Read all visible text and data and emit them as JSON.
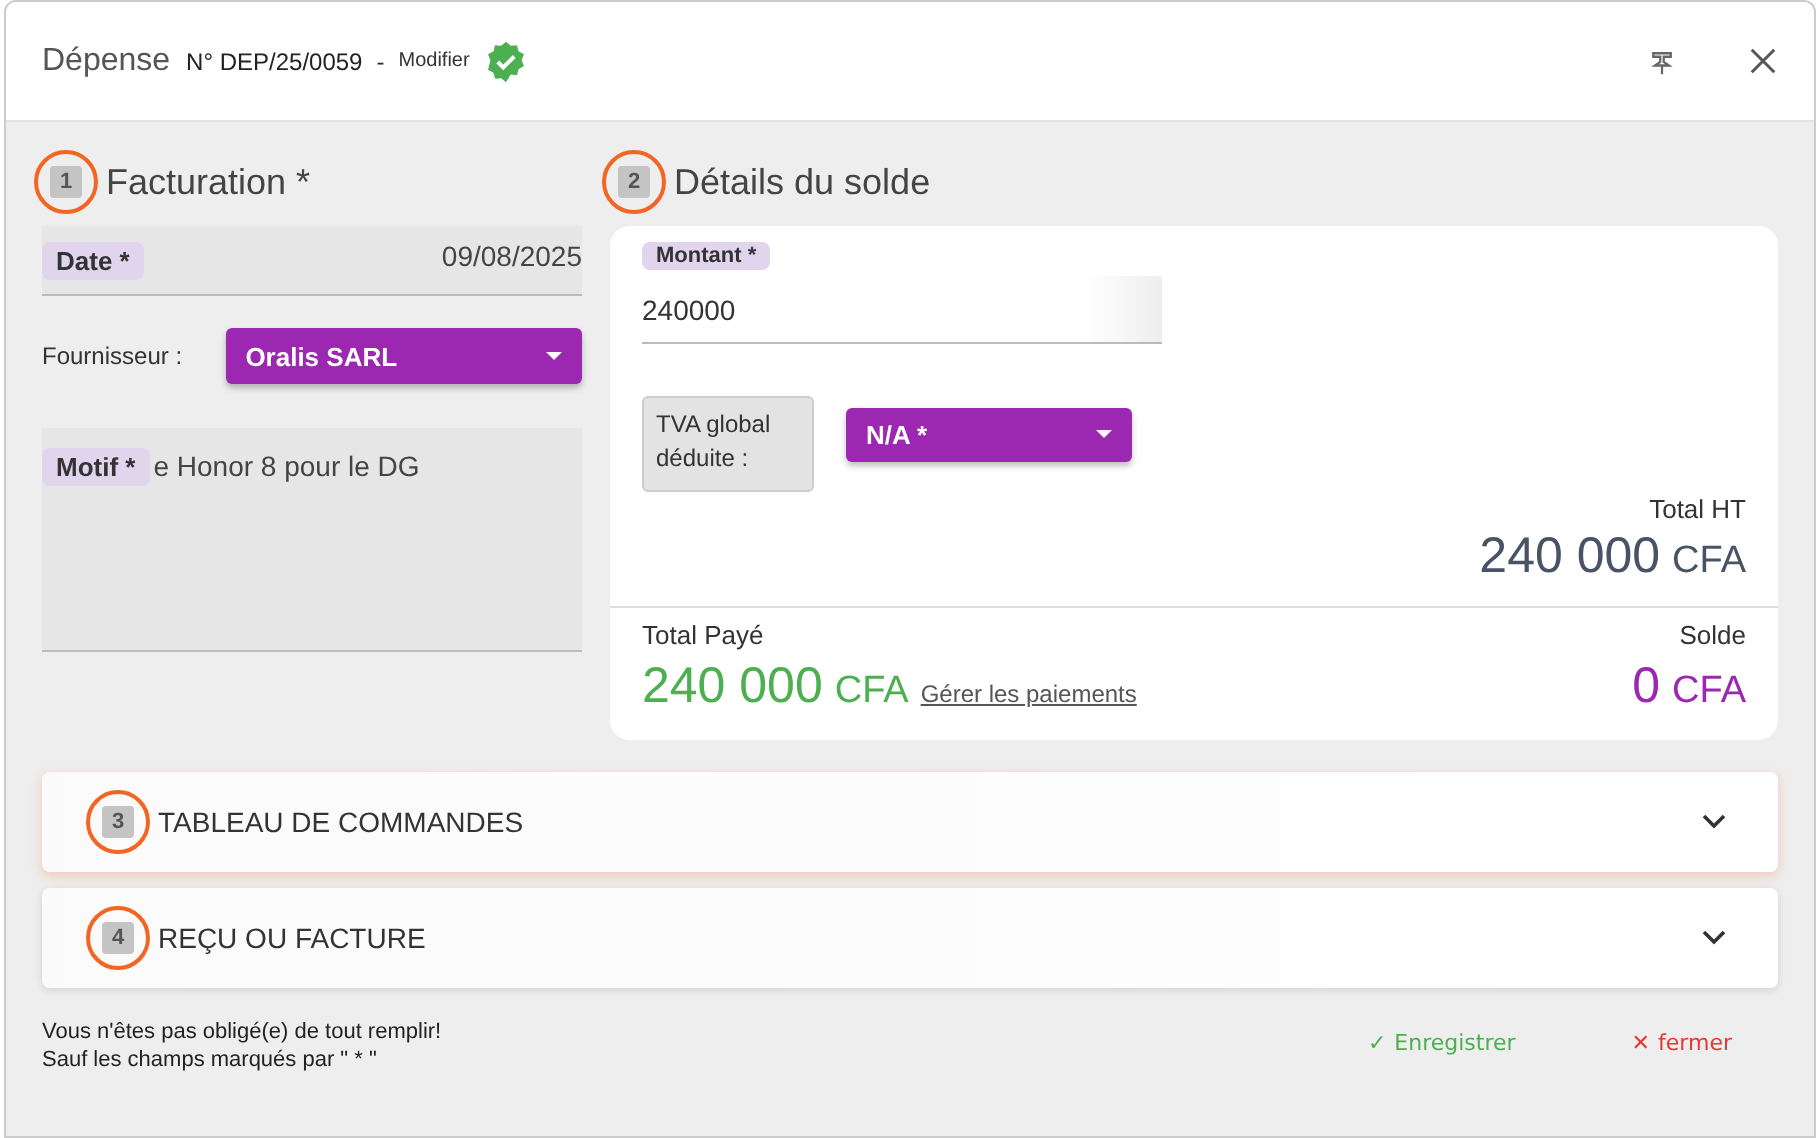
{
  "header": {
    "title": "Dépense",
    "reference": "N° DEP/25/0059",
    "separator": "-",
    "mode": "Modifier",
    "validated": true
  },
  "sections": [
    {
      "number": "1",
      "title": "Facturation *",
      "highlighted": true
    },
    {
      "number": "2",
      "title": "Détails du solde",
      "highlighted": true
    }
  ],
  "facturation": {
    "date": {
      "label": "Date *",
      "value": "09/08/2025"
    },
    "supplier": {
      "label": "Fournisseur :",
      "value": "Oralis SARL"
    },
    "motif": {
      "label": "Motif *",
      "value": "e Honor 8 pour le DG"
    }
  },
  "solde": {
    "amount": {
      "label": "Montant *",
      "value": "240000"
    },
    "tva": {
      "label": "TVA global déduite :",
      "value": "N/A *"
    },
    "total_ht": {
      "label": "Total HT",
      "amount": "240 000",
      "currency": "CFA"
    },
    "total_paid": {
      "label": "Total Payé",
      "amount": "240 000",
      "currency": "CFA",
      "link": "Gérer les paiements"
    },
    "balance": {
      "label": "Solde",
      "amount": "0",
      "currency": "CFA"
    }
  },
  "panels": [
    {
      "number": "3",
      "title": "TABLEAU DE COMMANDES",
      "expanded": false,
      "highlighted": true
    },
    {
      "number": "4",
      "title": "REÇU OU FACTURE",
      "expanded": false,
      "highlighted": true
    }
  ],
  "footer": {
    "note_lines": [
      "Vous n'êtes pas obligé(e) de tout remplir!",
      "Sauf les champs marqués par \" * \""
    ],
    "save": {
      "icon": "✓",
      "label": "Enregistrer"
    },
    "close": {
      "icon": "✕",
      "label": "fermer"
    }
  }
}
